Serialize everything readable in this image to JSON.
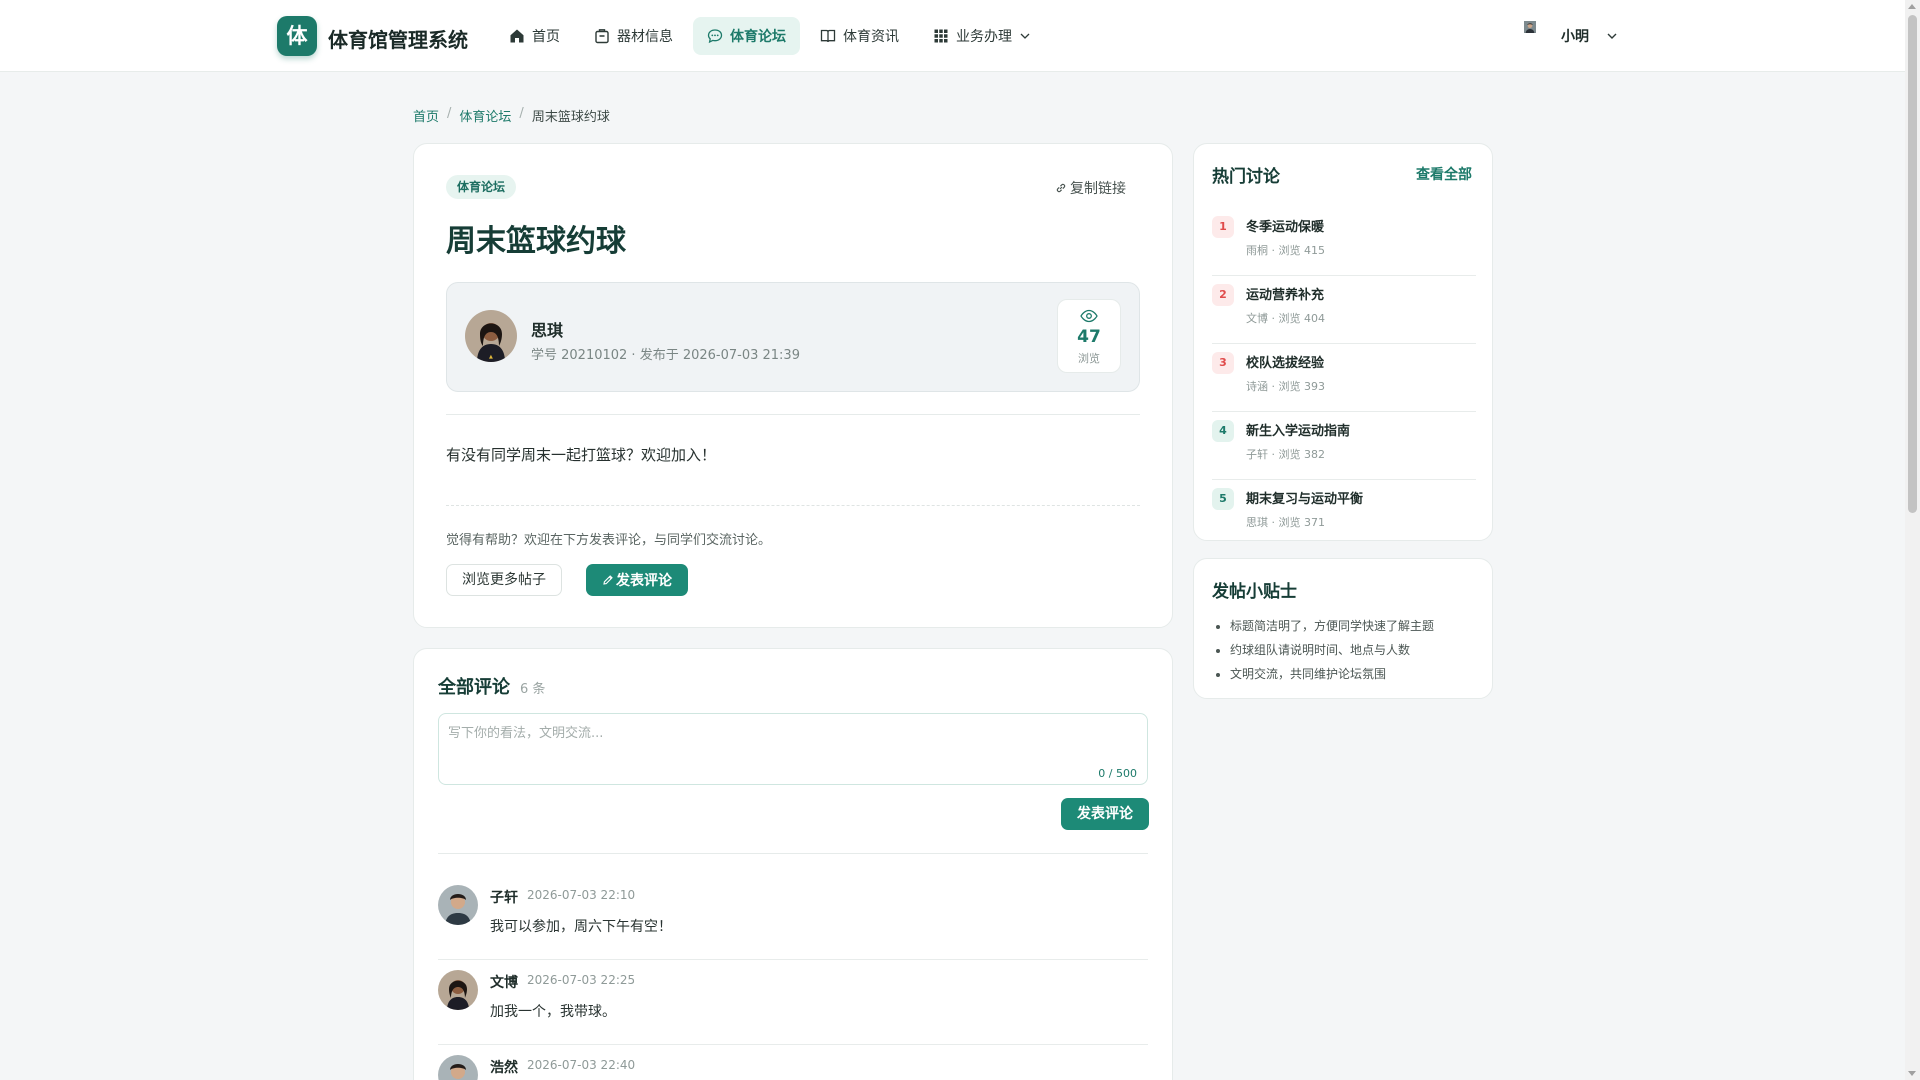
{
  "app": {
    "logo_char": "体",
    "title": "体育馆管理系统"
  },
  "nav": {
    "items": [
      {
        "label": "首页",
        "icon": "home-icon"
      },
      {
        "label": "器材信息",
        "icon": "box-icon"
      },
      {
        "label": "体育论坛",
        "icon": "chat-icon",
        "active": true
      },
      {
        "label": "体育资讯",
        "icon": "book-icon"
      },
      {
        "label": "业务办理",
        "icon": "grid-icon"
      }
    ]
  },
  "user": {
    "name": "小明"
  },
  "breadcrumb": {
    "home": "首页",
    "sep": "/",
    "forum": "体育论坛",
    "current": "周末篮球约球"
  },
  "post": {
    "tag": "体育论坛",
    "copy_link": "复制链接",
    "title": "周末篮球约球",
    "author_name": "思琪",
    "author_meta": "学号 20210102 · 发布于 2026-07-03 21:39",
    "view_count": "47",
    "view_label": "浏览",
    "body": "有没有同学周末一起打篮球？欢迎加入！",
    "help_text": "觉得有帮助？欢迎在下方发表评论，与同学们交流讨论。",
    "browse_more": "浏览更多帖子",
    "comment_button": "发表评论"
  },
  "comments": {
    "title": "全部评论",
    "count": "6 条",
    "placeholder": "写下你的看法，文明交流...",
    "char_counter": "0 / 500",
    "submit": "发表评论",
    "items": [
      {
        "name": "子轩",
        "time": "2026-07-03 22:10",
        "text": "我可以参加，周六下午有空！"
      },
      {
        "name": "文博",
        "time": "2026-07-03 22:25",
        "text": "加我一个，我带球。"
      },
      {
        "name": "浩然",
        "time": "2026-07-03 22:40",
        "text": ""
      }
    ]
  },
  "hot": {
    "title": "热门讨论",
    "view_all": "查看全部",
    "items": [
      {
        "rank": "1",
        "title": "冬季运动保暖",
        "meta": "雨桐 · 浏览 415"
      },
      {
        "rank": "2",
        "title": "运动营养补充",
        "meta": "文博 · 浏览 404"
      },
      {
        "rank": "3",
        "title": "校队选拔经验",
        "meta": "诗涵 · 浏览 393"
      },
      {
        "rank": "4",
        "title": "新生入学运动指南",
        "meta": "子轩 · 浏览 382"
      },
      {
        "rank": "5",
        "title": "期末复习与运动平衡",
        "meta": "思琪 · 浏览 371"
      }
    ]
  },
  "tips": {
    "title": "发帖小贴士",
    "items": [
      "标题简洁明了，方便同学快速了解主题",
      "约球组队请说明时间、地点与人数",
      "文明交流，共同维护论坛氛围"
    ]
  },
  "colors": {
    "accent": "#1d7a6a",
    "primary_button": "#1d8a77",
    "rank_hot": "#e04b4b"
  }
}
